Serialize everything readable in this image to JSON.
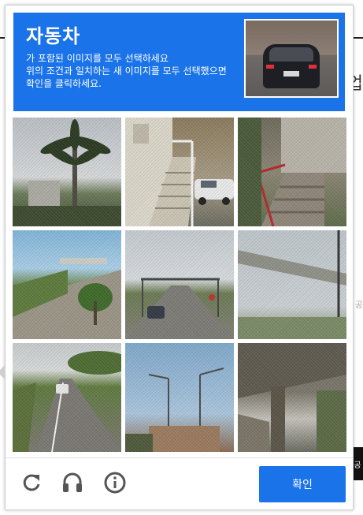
{
  "page_bg": {
    "right_char": "업",
    "right_text": "공",
    "edge_badge": "공"
  },
  "captcha": {
    "title": "자동차",
    "instructions": "가 포함된 이미지를 모두 선택하세요\n위의 조건과 일치하는 새 이미지를 모두 선택했으면 확인을 클릭하세요.",
    "accent_color": "#1a73e8",
    "sample_image": "rear-of-dark-car",
    "tiles": [
      {
        "label": "palm-tree"
      },
      {
        "label": "stairs-and-car"
      },
      {
        "label": "porch-stairs"
      },
      {
        "label": "road-with-palm"
      },
      {
        "label": "highway-with-car"
      },
      {
        "label": "overpass"
      },
      {
        "label": "road-with-car"
      },
      {
        "label": "street-lights"
      },
      {
        "label": "bridge-underside"
      }
    ],
    "footer": {
      "reload_icon": "reload-icon",
      "audio_icon": "headphones-icon",
      "info_icon": "info-icon",
      "verify_label": "확인"
    }
  }
}
